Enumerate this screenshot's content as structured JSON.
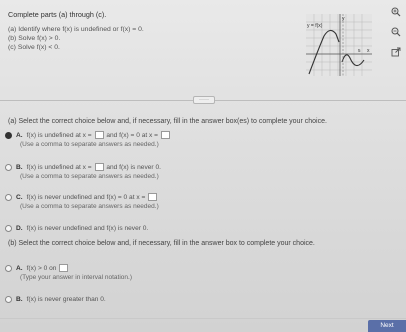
{
  "prompt": {
    "intro": "Complete parts (a) through (c).",
    "part_a": "(a) Identify where f(x) is undefined or f(x) = 0.",
    "part_b": "(b) Solve f(x) > 0.",
    "part_c": "(c) Solve f(x) < 0."
  },
  "graph": {
    "y_label": "y",
    "x_label": "x",
    "function_label": "y = f(x)",
    "tick_label": "5"
  },
  "icons": {
    "zoom_in": "zoom-in-icon",
    "zoom_out": "zoom-out-icon",
    "popout": "popout-icon"
  },
  "more_button": "·····",
  "question_a": {
    "instruction": "(a) Select the correct choice below and, if necessary, fill in the answer box(es) to complete your choice.",
    "options": [
      {
        "letter": "A.",
        "text_1": "f(x) is undefined at x =",
        "text_2": "and f(x) = 0 at x =",
        "hint": "(Use a comma to separate answers as needed.)"
      },
      {
        "letter": "B.",
        "text_1": "f(x) is undefined at x =",
        "text_2": "and f(x) is never 0.",
        "hint": "(Use a comma to separate answers as needed.)"
      },
      {
        "letter": "C.",
        "text_1": "f(x) is never undefined and f(x) = 0 at x =",
        "hint": "(Use a comma to separate answers as needed.)"
      },
      {
        "letter": "D.",
        "text_1": "f(x) is never undefined and f(x) is never 0."
      }
    ],
    "selected": "A."
  },
  "question_b": {
    "instruction": "(b) Select the correct choice below and, if necessary, fill in the answer box to complete your choice.",
    "options": [
      {
        "letter": "A.",
        "text_1": "f(x) > 0 on",
        "hint": "(Type your answer in interval notation.)"
      },
      {
        "letter": "B.",
        "text_1": "f(x) is never greater than 0."
      }
    ]
  },
  "next_button": "Next"
}
